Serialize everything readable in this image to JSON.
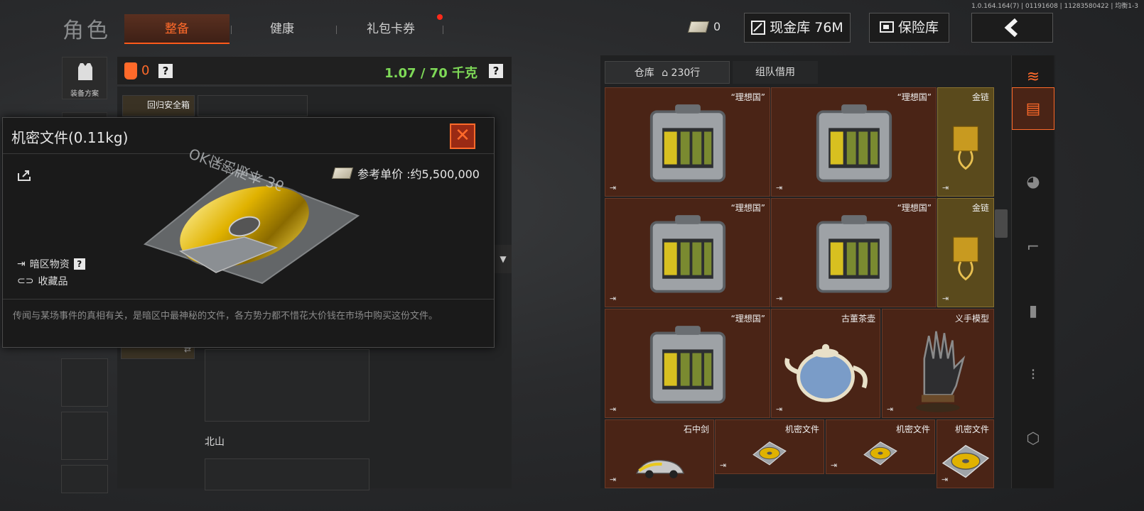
{
  "version": "1.0.164.164(7) | 01191608 | 11283580422 | 均衡1-3",
  "page_title": "角色",
  "tabs": [
    {
      "label": "整备",
      "active": true
    },
    {
      "label": "健康",
      "active": false
    },
    {
      "label": "礼包卡券",
      "active": false,
      "notify": true
    }
  ],
  "top_right": {
    "ticket_count": "0",
    "cash": "现金库 76M",
    "vault": "保险库",
    "back_icon": "chevron-left-icon"
  },
  "equip_header": {
    "armor_count": "0",
    "weight": "1.07 / 70 千克",
    "help": "?"
  },
  "side": {
    "loadout_label": "装备方案"
  },
  "safe_box_label": "回归安全箱",
  "section_north": "北山",
  "popup": {
    "title": "机密文件(0.11kg)",
    "ref_price": "参考单价 :约5,500,000",
    "disc_label": "OK保密版本  36",
    "tag_darkzone": "暗区物资",
    "tag_collectible": "收藏品",
    "help": "?",
    "description": "传闻与某场事件的真相有关，是暗区中最神秘的文件，各方势力都不惜花大价钱在市场中购买这份文件。"
  },
  "warehouse": {
    "tab_storage": "仓库",
    "tab_storage_rows": "230行",
    "tab_team": "组队借用",
    "items": [
      {
        "name": "“理想国”",
        "type": "case"
      },
      {
        "name": "“理想国”",
        "type": "case"
      },
      {
        "name": "金链",
        "type": "chain"
      },
      {
        "name": "“理想国”",
        "type": "case"
      },
      {
        "name": "“理想国”",
        "type": "case"
      },
      {
        "name": "金链",
        "type": "chain"
      },
      {
        "name": "“理想国”",
        "type": "case"
      },
      {
        "name": "古董茶壶",
        "type": "teapot"
      },
      {
        "name": "义手模型",
        "type": "hand"
      },
      {
        "name": "石中剑",
        "type": "car"
      },
      {
        "name": "机密文件",
        "type": "file"
      },
      {
        "name": "机密文件",
        "type": "file"
      },
      {
        "name": "机密文件",
        "type": "file"
      }
    ]
  },
  "categories": [
    "layers-icon",
    "box-icon",
    "helmet-icon",
    "rifle-icon",
    "magazine-icon",
    "ammo-icon",
    "gear-icon"
  ],
  "colors": {
    "accent": "#ff6a2a",
    "weight_green": "#7ed957",
    "cell_brown": "#4a2416",
    "cell_gold": "#5a4a1c"
  }
}
